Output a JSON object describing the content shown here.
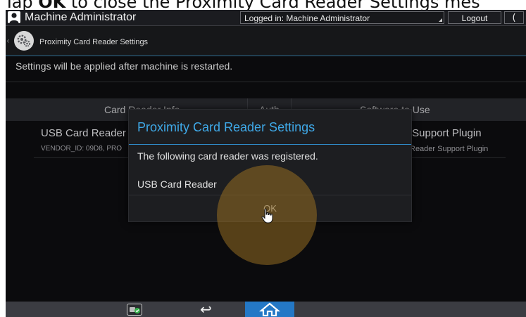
{
  "caption": {
    "prefix": "Tap ",
    "bold": "OK",
    "suffix": " to close the Proximity Card Reader Settings mes"
  },
  "topbar": {
    "user_name": "Machine Administrator",
    "login_status": "Logged in: Machine Administrator",
    "logout_label": "Logout",
    "moon_label": "("
  },
  "header": {
    "title": "Proximity Card Reader Settings",
    "back": "‹"
  },
  "notice": "Settings will be applied after machine is restarted.",
  "table": {
    "columns": [
      "Card Reader Info",
      "Auth",
      "Software to Use"
    ],
    "rows": [
      {
        "name": "USB Card Reader",
        "vendor": "VENDOR_ID: 09D8, PRO",
        "software": "r Support Plugin",
        "software_sub": "Reader Support Plugin"
      }
    ]
  },
  "dialog": {
    "title": "Proximity Card Reader Settings",
    "message": "The following card reader was registered.",
    "reader_name": "USB Card Reader",
    "ok_label": "OK"
  },
  "bottombar": {
    "back_glyph": "↩"
  },
  "colors": {
    "accent": "#3fa9e8",
    "home_blue": "#2478c6",
    "touch": "#966e23"
  }
}
